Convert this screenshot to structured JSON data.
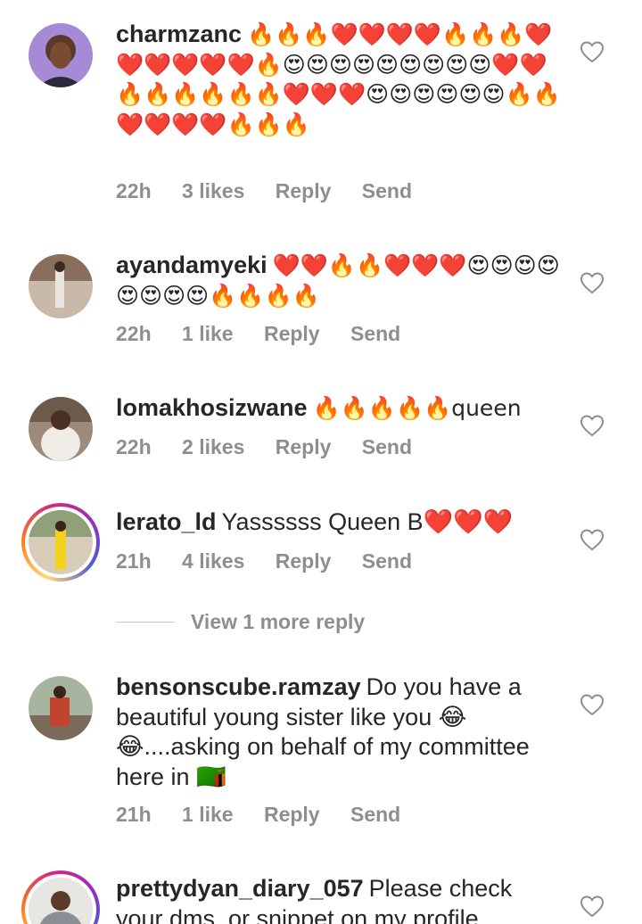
{
  "comments": [
    {
      "username": "charmzanc",
      "text": "🔥🔥🔥❤️❤️❤️❤️🔥🔥🔥❤️❤️❤️❤️❤️❤️🔥😍😍😍😍😍😍😍😍😍❤️❤️🔥🔥🔥🔥🔥🔥❤️❤️❤️😍😍😍😍😍😍🔥🔥❤️❤️❤️❤️🔥🔥🔥",
      "time": "22h",
      "likes": "3 likes",
      "reply_label": "Reply",
      "send_label": "Send"
    },
    {
      "username": "ayandamyeki",
      "text": "❤️❤️🔥🔥❤️❤️❤️😍😍😍😍😍😍😍😍🔥🔥🔥🔥",
      "time": "22h",
      "likes": "1 like",
      "reply_label": "Reply",
      "send_label": "Send"
    },
    {
      "username": "lomakhosizwane",
      "text": "🔥🔥🔥🔥🔥queen",
      "time": "22h",
      "likes": "2 likes",
      "reply_label": "Reply",
      "send_label": "Send"
    },
    {
      "username": "lerato_ld",
      "text": "Yassssss Queen B❤️❤️❤️",
      "time": "21h",
      "likes": "4 likes",
      "reply_label": "Reply",
      "send_label": "Send"
    },
    {
      "username": "bensonscube.ramzay",
      "text": "Do you have a beautiful young sister like you 😂😂....asking on behalf of my committee here in 🇿🇲",
      "time": "21h",
      "likes": "1 like",
      "reply_label": "Reply",
      "send_label": "Send"
    },
    {
      "username": "prettydyan_diary_057",
      "text": "Please check your dms, or snippet on my profile"
    }
  ],
  "view_more_label": "View 1 more reply",
  "colors": {
    "text": "#262626",
    "meta": "#8e8e8e",
    "heart_icon": "heart-outline-icon"
  }
}
